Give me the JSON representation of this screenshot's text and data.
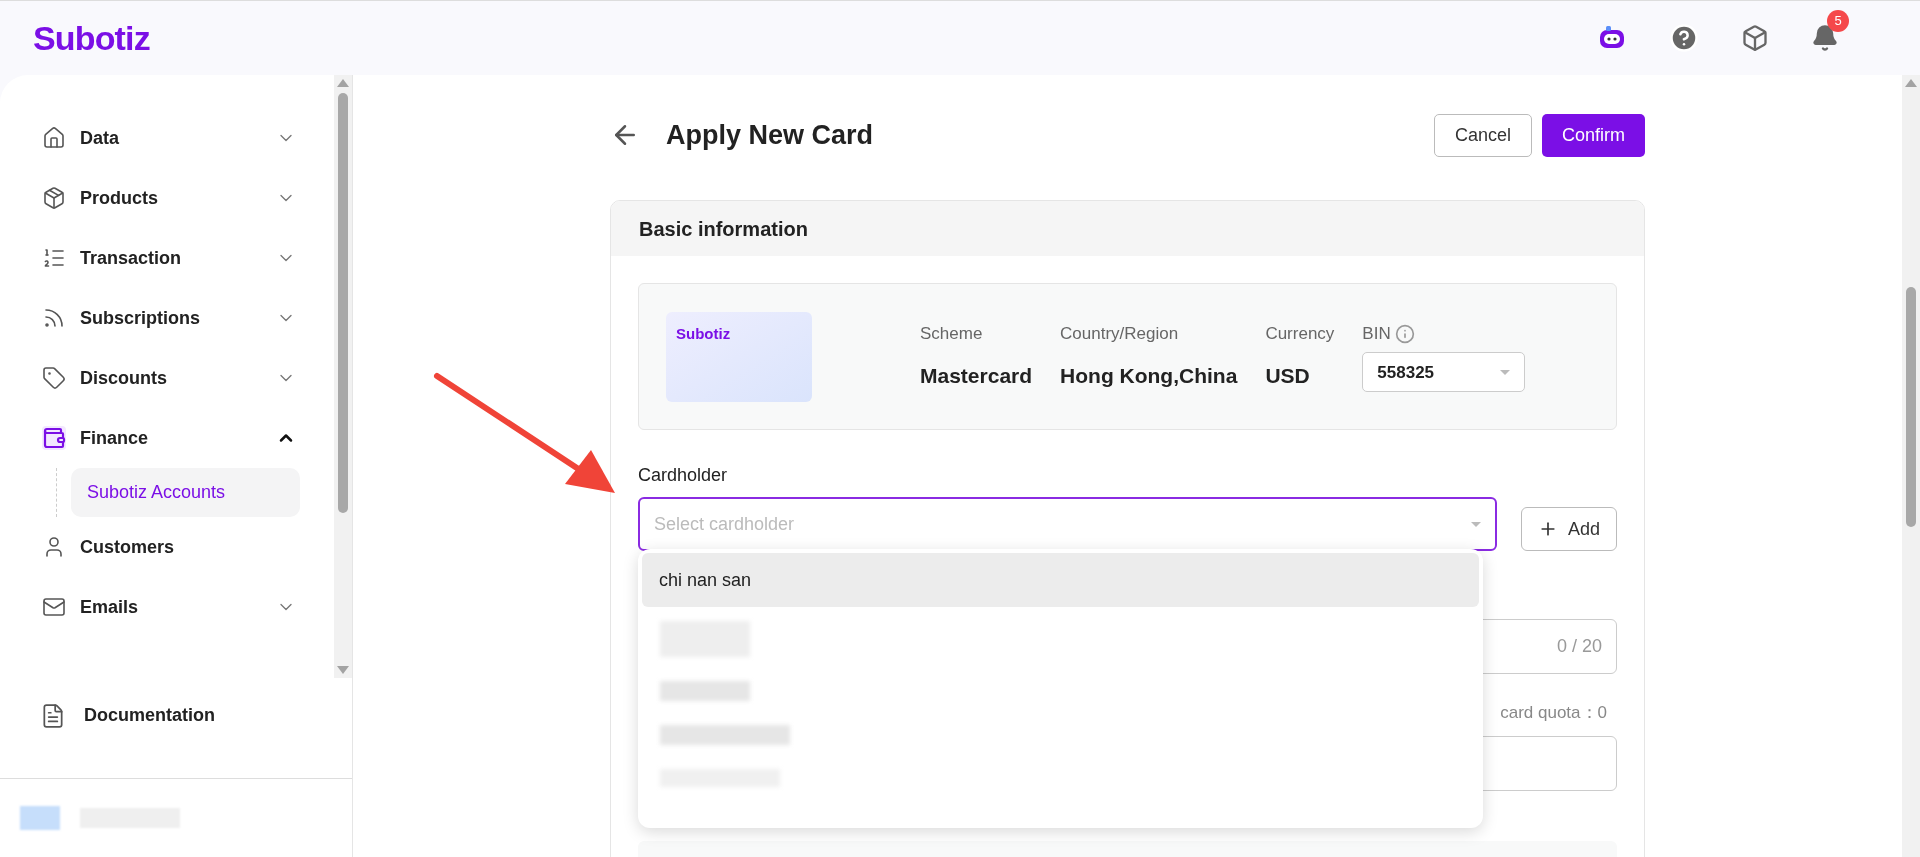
{
  "header": {
    "logo": "Subotiz",
    "notification_count": "5"
  },
  "sidebar": {
    "items": [
      {
        "label": "Data",
        "expandable": true,
        "expanded": false,
        "selected": false
      },
      {
        "label": "Products",
        "expandable": true,
        "expanded": false,
        "selected": false
      },
      {
        "label": "Transaction",
        "expandable": true,
        "expanded": false,
        "selected": false
      },
      {
        "label": "Subscriptions",
        "expandable": true,
        "expanded": false,
        "selected": false
      },
      {
        "label": "Discounts",
        "expandable": true,
        "expanded": false,
        "selected": false
      },
      {
        "label": "Finance",
        "expandable": true,
        "expanded": true,
        "selected": true,
        "children": [
          {
            "label": "Subotiz Accounts",
            "selected": true
          }
        ]
      },
      {
        "label": "Customers",
        "expandable": false,
        "selected": false
      },
      {
        "label": "Emails",
        "expandable": true,
        "expanded": false,
        "selected": false
      }
    ],
    "footer_link": "Documentation"
  },
  "page": {
    "title": "Apply New Card",
    "buttons": [
      {
        "label": "Cancel",
        "kind": "secondary"
      },
      {
        "label": "Confirm",
        "kind": "primary"
      }
    ]
  },
  "basic_info": {
    "title": "Basic information",
    "card_brand": "Subotiz",
    "fields": [
      {
        "label": "Scheme",
        "value": "Mastercard"
      },
      {
        "label": "Country/Region",
        "value": "Hong Kong,China"
      },
      {
        "label": "Currency",
        "value": "USD"
      }
    ],
    "bin": {
      "label": "BIN",
      "value": "558325"
    }
  },
  "cardholder": {
    "label": "Cardholder",
    "placeholder": "Select cardholder",
    "add_button": "Add",
    "options": [
      {
        "label": "chi nan san",
        "selected": true
      }
    ]
  },
  "behind": {
    "counter": "0 / 20",
    "quota": "card quota：0"
  }
}
